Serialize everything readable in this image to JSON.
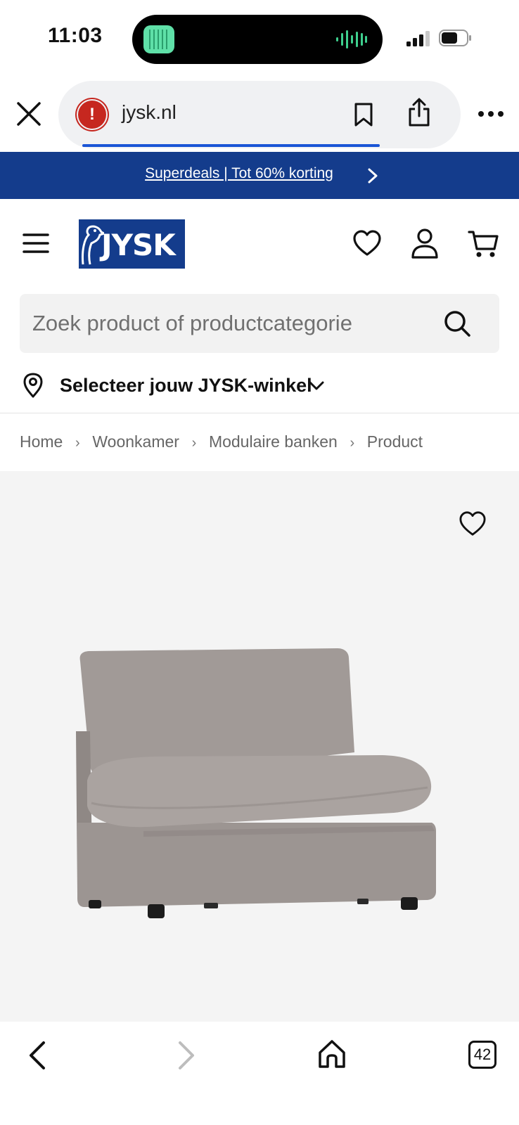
{
  "status_bar": {
    "time": "11:03"
  },
  "browser": {
    "url": "jysk.nl",
    "load_progress": 0.84
  },
  "promo": {
    "text": "Superdeals | Tot 60% korting"
  },
  "header": {
    "logo_text": "JYSK"
  },
  "search": {
    "placeholder": "Zoek product of productcategorie"
  },
  "store": {
    "label": "Selecteer jouw JYSK-winkel"
  },
  "breadcrumb": [
    "Home",
    "Woonkamer",
    "Modulaire banken",
    "Product"
  ],
  "bottom_nav": {
    "tab_count": "42"
  },
  "icons": {
    "close": "close-icon",
    "warning": "warning-icon",
    "bookmark": "bookmark-icon",
    "share": "share-icon",
    "more": "more-icon",
    "menu": "hamburger-icon",
    "wishlist": "heart-icon",
    "account": "user-icon",
    "cart": "cart-icon",
    "search": "search-icon",
    "location": "pin-icon",
    "back": "back-icon",
    "forward": "forward-icon",
    "home": "home-icon"
  },
  "colors": {
    "brand": "#143c8c",
    "warning": "#c6271f",
    "progress": "#1a55d6"
  }
}
